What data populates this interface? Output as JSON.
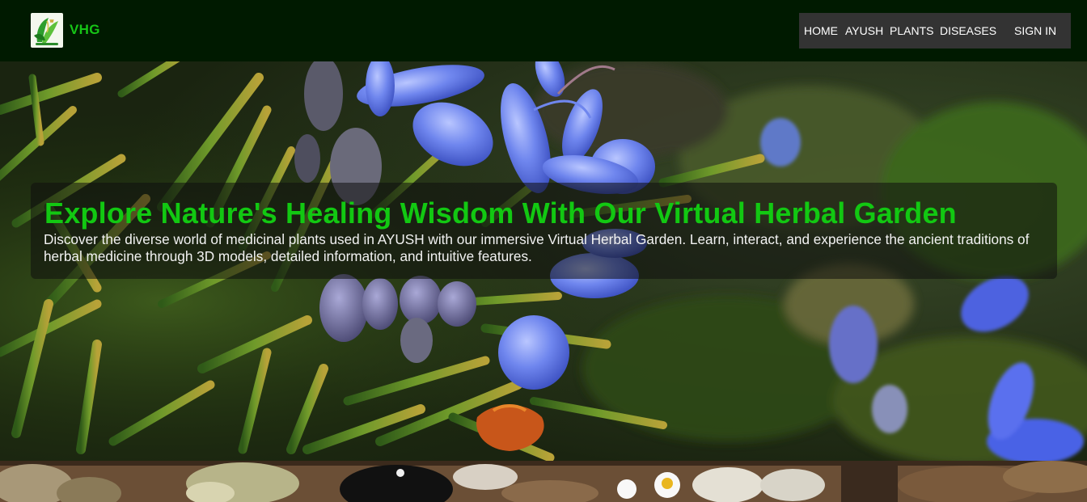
{
  "brand": {
    "name": "VHG",
    "logo": "herbal-leaf-logo"
  },
  "nav": {
    "items": [
      {
        "label": "HOME"
      },
      {
        "label": "AYUSH"
      },
      {
        "label": "PLANTS"
      },
      {
        "label": "DISEASES"
      }
    ],
    "signin_label": "SIGN IN"
  },
  "hero": {
    "title": "Explore Nature's Healing Wisdom With Our Virtual Herbal Garden",
    "description": "Discover the diverse world of medicinal plants used in AYUSH with our immersive Virtual Herbal Garden. Learn, interact, and experience the ancient traditions of herbal medicine through 3D models, detailed information, and intuitive features.",
    "background": "rosemary-flowers-photo"
  },
  "colors": {
    "accent": "#12c812",
    "navbar_bg": "#001a00",
    "nav_box_bg": "#333333"
  }
}
